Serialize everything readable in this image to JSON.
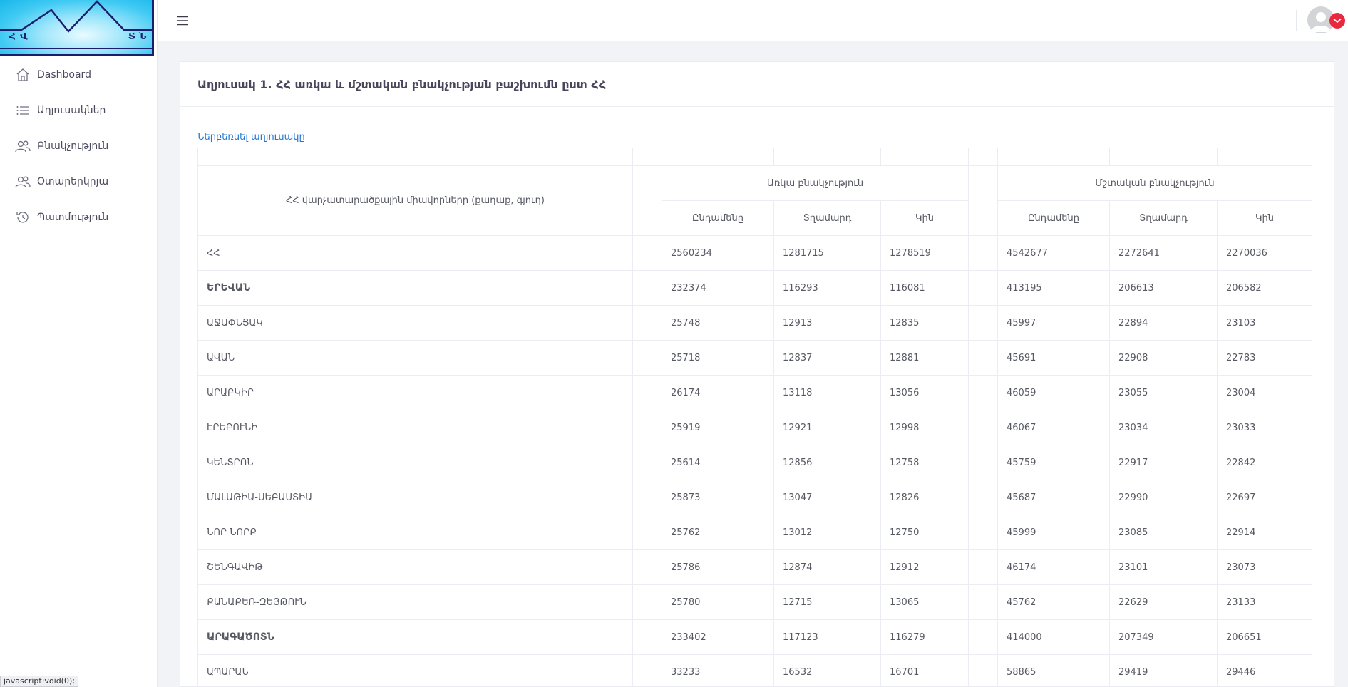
{
  "logo": {
    "letters_left": "ՀՎ",
    "letters_right": "ՏՆ"
  },
  "sidebar": {
    "items": [
      {
        "label": "Dashboard",
        "icon": "home-icon"
      },
      {
        "label": "Աղյուսակներ",
        "icon": "list-icon"
      },
      {
        "label": "Բնակչություն",
        "icon": "users-icon"
      },
      {
        "label": "Օտարերկրյա",
        "icon": "users-icon"
      },
      {
        "label": "Պատմություն",
        "icon": "history-icon"
      }
    ]
  },
  "status_tip": "javascript:void(0);",
  "card": {
    "title": "Աղյուսակ 1. ՀՀ առկա և մշտական բնակչության բաշխումն ըստ ՀՀ",
    "download_label": "Ներբեռնել աղյուսակը"
  },
  "table": {
    "region_header": "ՀՀ վարչատարածքային միավորները (քաղաք, գյուղ)",
    "group_present": "Առկա բնակչություն",
    "group_permanent": "Մշտական բնակչություն",
    "sub_total": "Ընդամենը",
    "sub_male": "Տղամարդ",
    "sub_female": "Կին",
    "rows": [
      {
        "name": "ՀՀ",
        "bold": false,
        "p_total": "2560234",
        "p_male": "1281715",
        "p_female": "1278519",
        "m_total": "4542677",
        "m_male": "2272641",
        "m_female": "2270036"
      },
      {
        "name": "ԵՐԵՎԱՆ",
        "bold": true,
        "p_total": "232374",
        "p_male": "116293",
        "p_female": "116081",
        "m_total": "413195",
        "m_male": "206613",
        "m_female": "206582"
      },
      {
        "name": "ԱՋԱՓՆՅԱԿ",
        "bold": false,
        "p_total": "25748",
        "p_male": "12913",
        "p_female": "12835",
        "m_total": "45997",
        "m_male": "22894",
        "m_female": "23103"
      },
      {
        "name": "ԱՎԱՆ",
        "bold": false,
        "p_total": "25718",
        "p_male": "12837",
        "p_female": "12881",
        "m_total": "45691",
        "m_male": "22908",
        "m_female": "22783"
      },
      {
        "name": "ԱՐԱԲԿԻՐ",
        "bold": false,
        "p_total": "26174",
        "p_male": "13118",
        "p_female": "13056",
        "m_total": "46059",
        "m_male": "23055",
        "m_female": "23004"
      },
      {
        "name": "ԷՐԵԲՈՒՆԻ",
        "bold": false,
        "p_total": "25919",
        "p_male": "12921",
        "p_female": "12998",
        "m_total": "46067",
        "m_male": "23034",
        "m_female": "23033"
      },
      {
        "name": "ԿԵՆՏՐՈՆ",
        "bold": false,
        "p_total": "25614",
        "p_male": "12856",
        "p_female": "12758",
        "m_total": "45759",
        "m_male": "22917",
        "m_female": "22842"
      },
      {
        "name": "ՄԱԼԱԹԻԱ-ՍԵԲԱՍՏԻԱ",
        "bold": false,
        "p_total": "25873",
        "p_male": "13047",
        "p_female": "12826",
        "m_total": "45687",
        "m_male": "22990",
        "m_female": "22697"
      },
      {
        "name": "ՆՈՐ ՆՈՐՔ",
        "bold": false,
        "p_total": "25762",
        "p_male": "13012",
        "p_female": "12750",
        "m_total": "45999",
        "m_male": "23085",
        "m_female": "22914"
      },
      {
        "name": "ՇԵՆԳԱՎԻԹ",
        "bold": false,
        "p_total": "25786",
        "p_male": "12874",
        "p_female": "12912",
        "m_total": "46174",
        "m_male": "23101",
        "m_female": "23073"
      },
      {
        "name": "ՔԱՆԱՔԵՌ-ԶԵՅԹՈՒՆ",
        "bold": false,
        "p_total": "25780",
        "p_male": "12715",
        "p_female": "13065",
        "m_total": "45762",
        "m_male": "22629",
        "m_female": "23133"
      },
      {
        "name": "ԱՐԱԳԱԾՈՏՆ",
        "bold": true,
        "p_total": "233402",
        "p_male": "117123",
        "p_female": "116279",
        "m_total": "414000",
        "m_male": "207349",
        "m_female": "206651"
      },
      {
        "name": "ԱՊԱՐԱՆ",
        "bold": false,
        "p_total": "33233",
        "p_male": "16532",
        "p_female": "16701",
        "m_total": "58865",
        "m_male": "29419",
        "m_female": "29446"
      }
    ]
  }
}
